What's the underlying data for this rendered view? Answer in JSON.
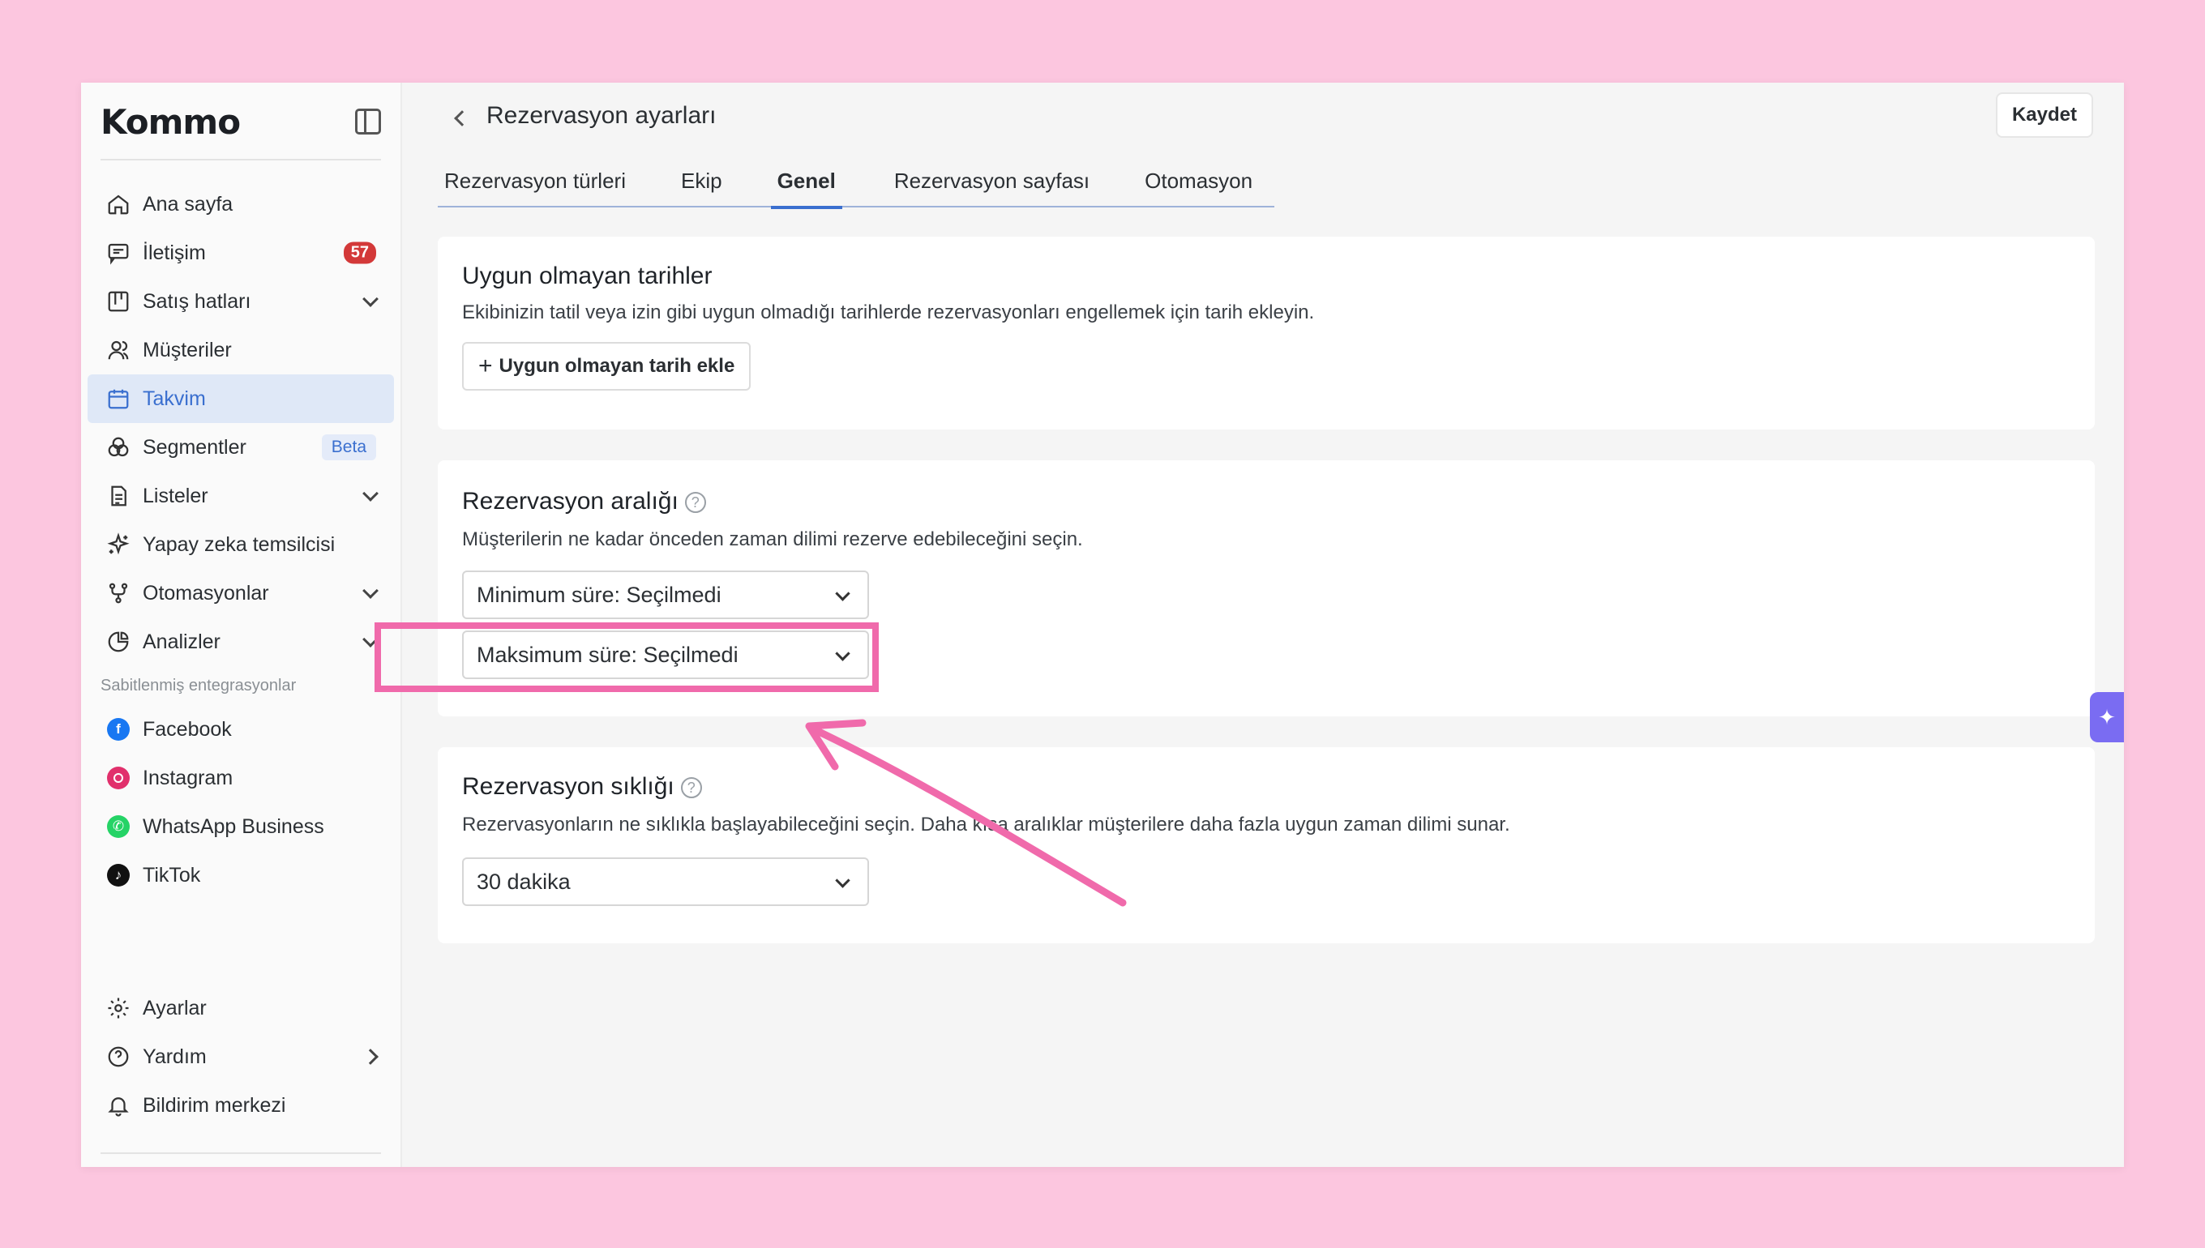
{
  "app": {
    "logo": "Kommo"
  },
  "sidebar": {
    "items": [
      {
        "label": "Ana sayfa",
        "icon": "home-icon"
      },
      {
        "label": "İletişim",
        "icon": "chat-icon",
        "badge": "57"
      },
      {
        "label": "Satış hatları",
        "icon": "pipeline-icon"
      },
      {
        "label": "Müşteriler",
        "icon": "users-icon"
      },
      {
        "label": "Takvim",
        "icon": "calendar-icon",
        "active": true
      },
      {
        "label": "Segmentler",
        "icon": "segments-icon",
        "badge": "Beta"
      },
      {
        "label": "Listeler",
        "icon": "list-icon"
      },
      {
        "label": "Yapay zeka temsilcisi",
        "icon": "sparkle-icon"
      },
      {
        "label": "Otomasyonlar",
        "icon": "automation-icon"
      },
      {
        "label": "Analizler",
        "icon": "chart-icon"
      }
    ],
    "section_label": "Sabitlenmiş entegrasyonlar",
    "integrations": [
      {
        "label": "Facebook",
        "icon": "facebook-icon",
        "color": "#1877f2"
      },
      {
        "label": "Instagram",
        "icon": "instagram-icon",
        "color": "#e1306c"
      },
      {
        "label": "WhatsApp Business",
        "icon": "whatsapp-icon",
        "color": "#25d366"
      },
      {
        "label": "TikTok",
        "icon": "tiktok-icon",
        "color": "#111111"
      }
    ],
    "bottom": [
      {
        "label": "Ayarlar",
        "icon": "gear-icon"
      },
      {
        "label": "Yardım",
        "icon": "help-icon"
      },
      {
        "label": "Bildirim merkezi",
        "icon": "bell-icon"
      }
    ]
  },
  "header": {
    "title": "Rezervasyon ayarları",
    "save_label": "Kaydet"
  },
  "tabs": [
    "Rezervasyon türleri",
    "Ekip",
    "Genel",
    "Rezervasyon sayfası",
    "Otomasyon"
  ],
  "active_tab": "Genel",
  "unavailable": {
    "title": "Uygun olmayan tarihler",
    "description": "Ekibinizin tatil veya izin gibi uygun olmadığı tarihlerde rezervasyonları engellemek için tarih ekleyin.",
    "button": "Uygun olmayan tarih ekle"
  },
  "range": {
    "title": "Rezervasyon aralığı",
    "description": "Müşterilerin ne kadar önceden zaman dilimi rezerve edebileceğini seçin.",
    "min_select": "Minimum süre: Seçilmedi",
    "max_select": "Maksimum süre: Seçilmedi"
  },
  "frequency": {
    "title": "Rezervasyon sıklığı",
    "description": "Rezervasyonların ne sıklıkla başlayabileceğini seçin. Daha kısa aralıklar müşterilere daha fazla uygun zaman dilimi sunar.",
    "select": "30 dakika"
  },
  "colors": {
    "accent": "#3a6fcf",
    "highlight": "#f06aab",
    "background": "#fcc6df"
  }
}
